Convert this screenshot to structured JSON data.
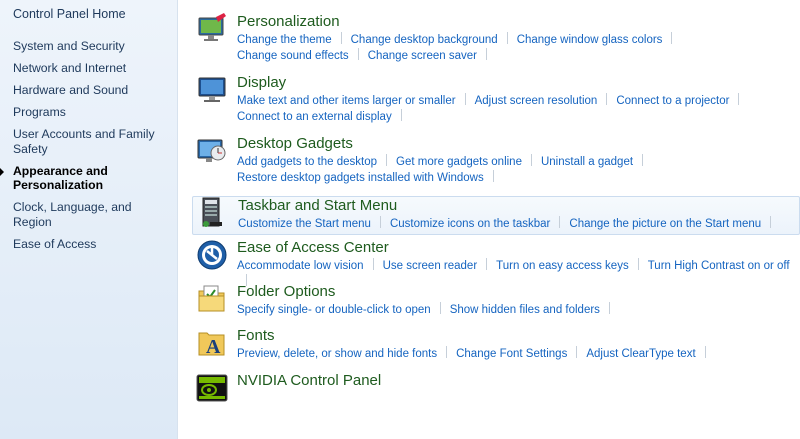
{
  "sidebar": {
    "home": "Control Panel Home",
    "items": [
      {
        "label": "System and Security"
      },
      {
        "label": "Network and Internet"
      },
      {
        "label": "Hardware and Sound"
      },
      {
        "label": "Programs"
      },
      {
        "label": "User Accounts and Family Safety"
      },
      {
        "label": "Appearance and Personalization",
        "active": true
      },
      {
        "label": "Clock, Language, and Region"
      },
      {
        "label": "Ease of Access"
      }
    ]
  },
  "categories": [
    {
      "title": "Personalization",
      "icon": "personalization-icon",
      "lines": [
        [
          "Change the theme",
          "Change desktop background",
          "Change window glass colors"
        ],
        [
          "Change sound effects",
          "Change screen saver"
        ]
      ]
    },
    {
      "title": "Display",
      "icon": "display-icon",
      "lines": [
        [
          "Make text and other items larger or smaller",
          "Adjust screen resolution",
          "Connect to a projector"
        ],
        [
          "Connect to an external display"
        ]
      ]
    },
    {
      "title": "Desktop Gadgets",
      "icon": "gadgets-icon",
      "lines": [
        [
          "Add gadgets to the desktop",
          "Get more gadgets online",
          "Uninstall a gadget"
        ],
        [
          "Restore desktop gadgets installed with Windows"
        ]
      ]
    },
    {
      "title": "Taskbar and Start Menu",
      "icon": "taskbar-icon",
      "hover": true,
      "lines": [
        [
          "Customize the Start menu",
          "Customize icons on the taskbar",
          "Change the picture on the Start menu"
        ]
      ]
    },
    {
      "title": "Ease of Access Center",
      "icon": "ease-of-access-icon",
      "lines": [
        [
          "Accommodate low vision",
          "Use screen reader",
          "Turn on easy access keys",
          "Turn High Contrast on or off"
        ]
      ]
    },
    {
      "title": "Folder Options",
      "icon": "folder-options-icon",
      "lines": [
        [
          "Specify single- or double-click to open",
          "Show hidden files and folders"
        ]
      ]
    },
    {
      "title": "Fonts",
      "icon": "fonts-icon",
      "lines": [
        [
          "Preview, delete, or show and hide fonts",
          "Change Font Settings",
          "Adjust ClearType text"
        ]
      ]
    },
    {
      "title": "NVIDIA Control Panel",
      "icon": "nvidia-icon",
      "lines": []
    }
  ],
  "colors": {
    "title_green": "#1e5b1e",
    "link_blue": "#1564c0",
    "sidebar_text": "#1e395b"
  }
}
